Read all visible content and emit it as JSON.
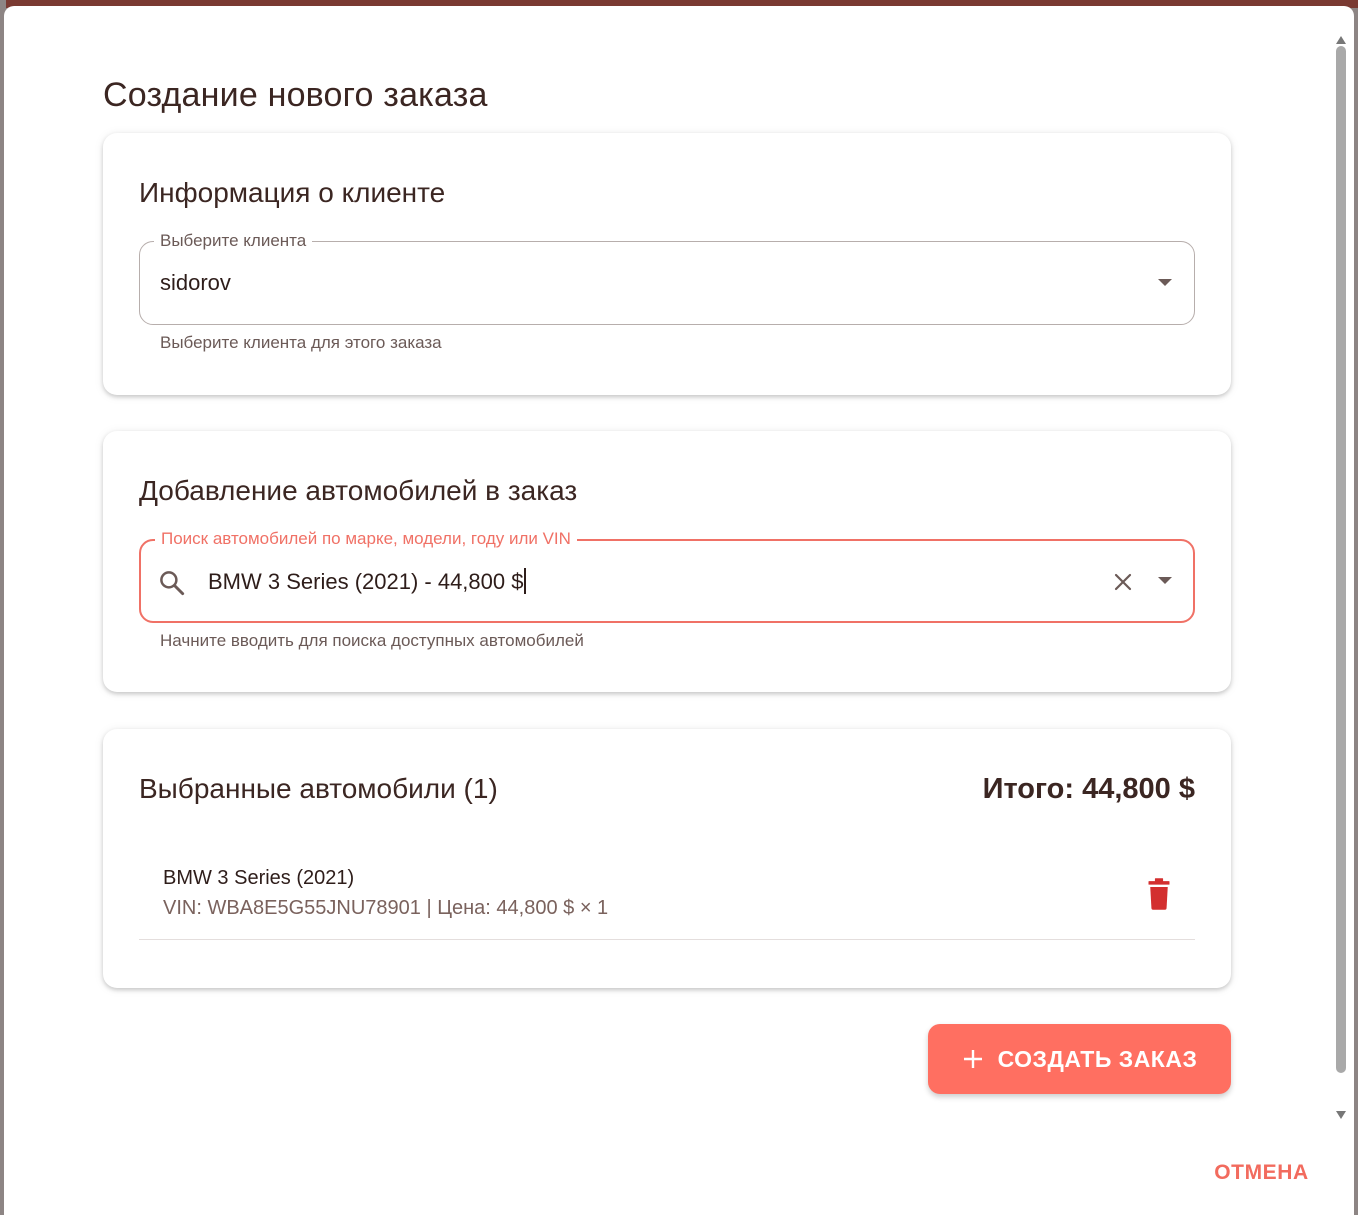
{
  "dialog": {
    "title": "Создание нового заказа"
  },
  "client_section": {
    "heading": "Информация о клиенте",
    "select_label": "Выберите клиента",
    "select_value": "sidorov",
    "helper": "Выберите клиента для этого заказа"
  },
  "cars_section": {
    "heading": "Добавление автомобилей в заказ",
    "search_label": "Поиск автомобилей по марке, модели, году или VIN",
    "search_value": "BMW 3 Series (2021) - 44,800 $",
    "helper": "Начните вводить для поиска доступных автомобилей"
  },
  "selected_section": {
    "heading": "Выбранные автомобили (1)",
    "total": "Итого: 44,800 $",
    "items": [
      {
        "name": "BMW 3 Series (2021)",
        "details": "VIN: WBA8E5G55JNU78901 | Цена: 44,800 $ × 1"
      }
    ]
  },
  "actions": {
    "create_label": "СОЗДАТЬ ЗАКАЗ",
    "cancel_label": "ОТМЕНА"
  },
  "colors": {
    "accent": "#ff6f61",
    "delete": "#d32f2f",
    "text": "#3b2622"
  },
  "icons": [
    "search-icon",
    "close-icon",
    "chevron-down-icon",
    "trash-icon",
    "plus-icon"
  ]
}
